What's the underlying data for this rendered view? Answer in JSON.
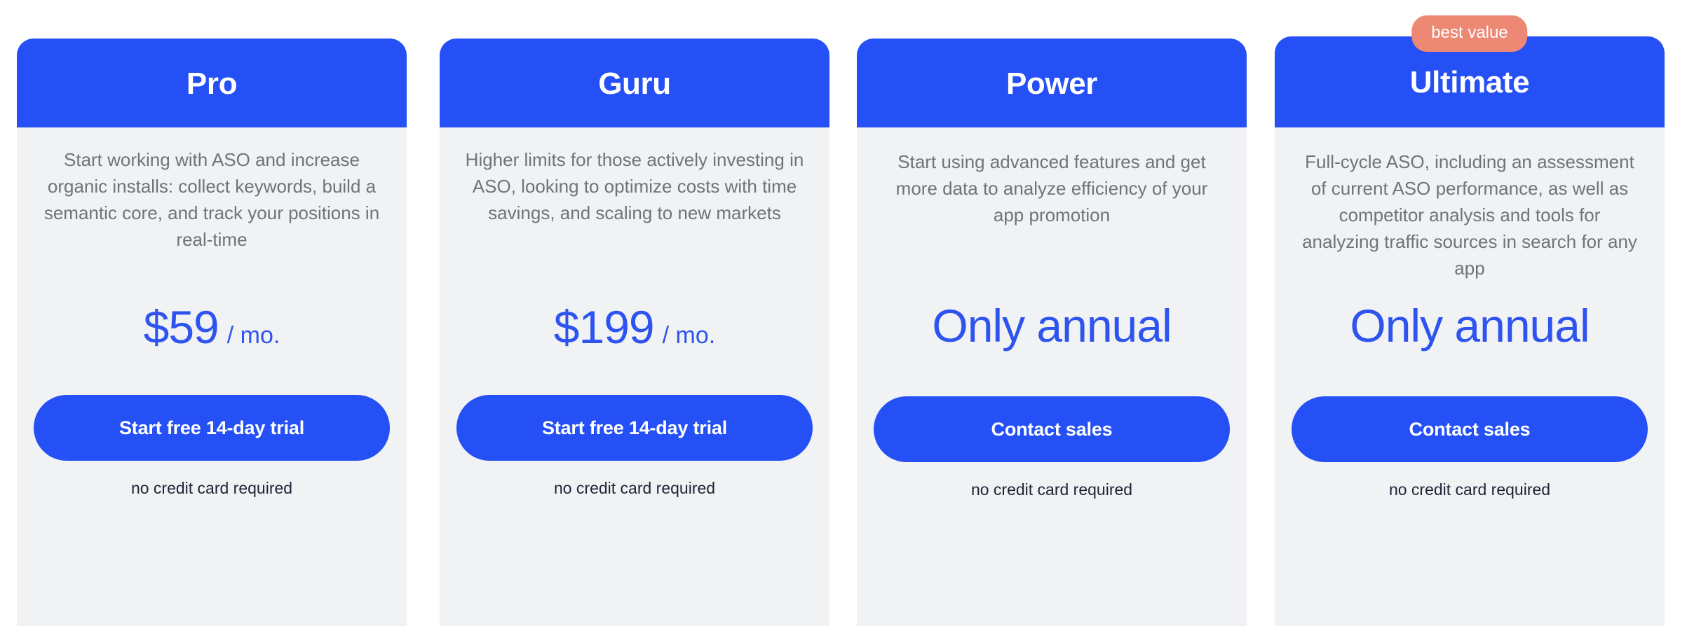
{
  "page": {
    "background_color": "#ffffff",
    "accent_blue": "#2450f5",
    "price_blue": "#2e54f0",
    "card_background": "#f1f2f4",
    "badge_color": "#ed8874",
    "description_color": "#6f7479",
    "note_color": "#1b2436"
  },
  "plans": [
    {
      "id": "pro",
      "name": "Pro",
      "badge": null,
      "description": "Start working with ASO and increase organic installs: collect keywords, build a semantic core, and track your positions in real-time",
      "price_amount": "$59",
      "price_period": "/ mo.",
      "cta_label": "Start free 14-day trial",
      "note": "no credit card required",
      "variant": "monthly"
    },
    {
      "id": "guru",
      "name": "Guru",
      "badge": null,
      "description": "Higher limits for those actively investing in ASO, looking to optimize costs with time savings, and scaling to new markets",
      "price_amount": "$199",
      "price_period": "/ mo.",
      "cta_label": "Start free 14-day trial",
      "note": "no credit card required",
      "variant": "monthly"
    },
    {
      "id": "power",
      "name": "Power",
      "badge": null,
      "description": "Start using advanced features and get more data to analyze efficiency of your app promotion",
      "price_amount": "Only annual",
      "price_period": "",
      "cta_label": "Contact sales",
      "note": "no credit card required",
      "variant": "annual"
    },
    {
      "id": "ultimate",
      "name": "Ultimate",
      "badge": "best value",
      "description": "Full-cycle ASO, including an assessment of current ASO performance, as well as competitor analysis and tools for analyzing traffic sources in search for any app",
      "price_amount": "Only annual",
      "price_period": "",
      "cta_label": "Contact sales",
      "note": "no credit card required",
      "variant": "annual"
    }
  ]
}
